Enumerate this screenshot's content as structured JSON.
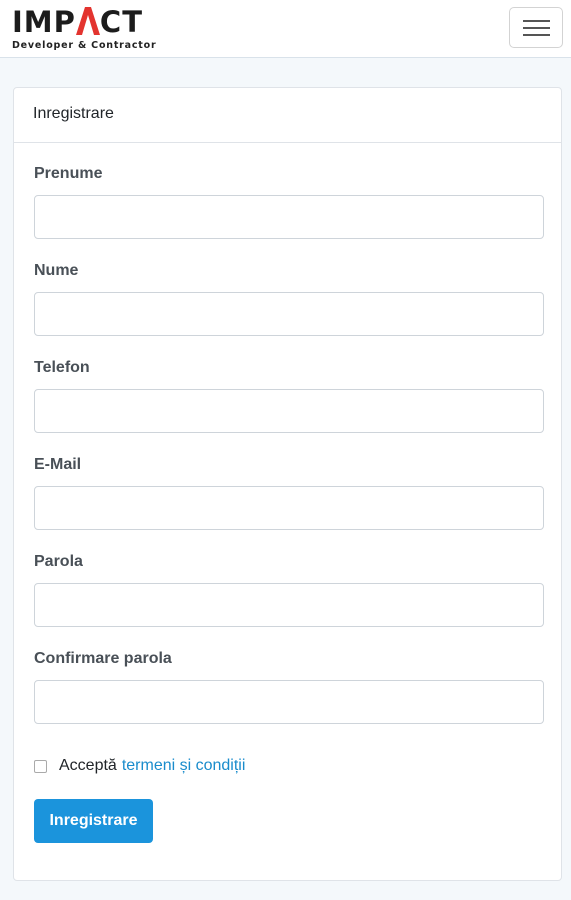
{
  "header": {
    "brand_name_before": "IMP",
    "brand_name_after": "CT",
    "brand_tagline": "Developer & Contractor",
    "brand_accent_color": "#e3342f",
    "menu_icon": "hamburger-menu-icon"
  },
  "card": {
    "title": "Inregistrare",
    "fields": [
      {
        "label": "Prenume",
        "value": "",
        "placeholder": ""
      },
      {
        "label": "Nume",
        "value": "",
        "placeholder": ""
      },
      {
        "label": "Telefon",
        "value": "",
        "placeholder": ""
      },
      {
        "label": "E-Mail",
        "value": "",
        "placeholder": ""
      },
      {
        "label": "Parola",
        "value": "",
        "placeholder": ""
      },
      {
        "label": "Confirmare parola",
        "value": "",
        "placeholder": ""
      }
    ],
    "terms": {
      "checked": false,
      "prefix": "Acceptă",
      "link_text": "termeni și condiții"
    },
    "submit_label": "Inregistrare"
  },
  "colors": {
    "primary": "#1b94dc",
    "link": "#1a8ccc",
    "page_background": "#f4f8fb"
  }
}
